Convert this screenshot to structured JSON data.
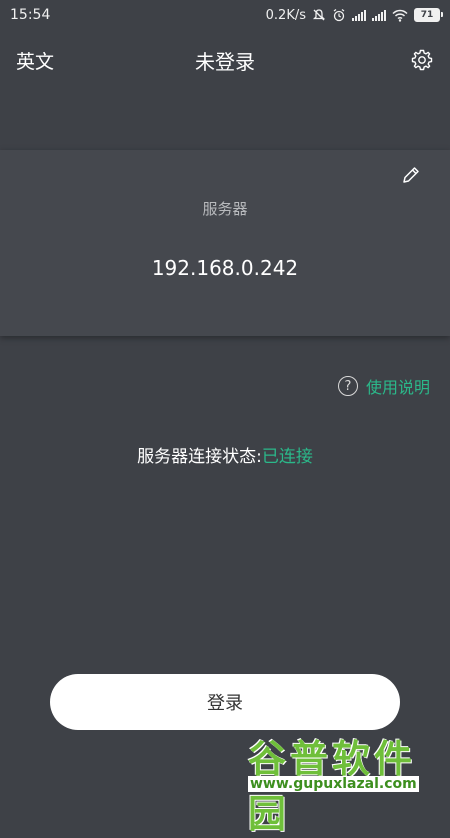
{
  "statusbar": {
    "time": "15:54",
    "speed": "0.2K/s",
    "battery": "71"
  },
  "toolbar": {
    "language": "英文",
    "title": "未登录"
  },
  "server": {
    "label": "服务器",
    "address": "192.168.0.242"
  },
  "help": {
    "icon_glyph": "?",
    "label": "使用说明"
  },
  "connection": {
    "label": "服务器连接状态:",
    "value": "已连接"
  },
  "login": {
    "label": "登录"
  },
  "watermark": {
    "name": "谷普软件园",
    "url": "www.gupuxlazal.com"
  },
  "colors": {
    "background": "#3e4147",
    "card": "#45484e",
    "accent": "#2bb88a"
  },
  "icons": [
    "mute-icon",
    "alarm-icon",
    "signal-icon",
    "wifi-icon",
    "battery-icon",
    "gear-icon",
    "pencil-icon",
    "question-icon"
  ]
}
